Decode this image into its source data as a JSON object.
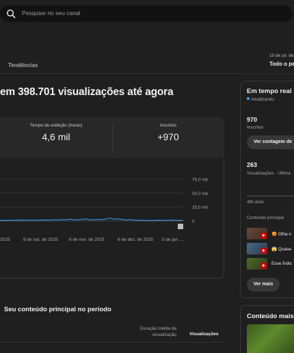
{
  "search": {
    "placeholder": "Pesquise no seu canal",
    "icon": "search-icon"
  },
  "nav": {
    "tab_trends": "Tendências"
  },
  "date_range": {
    "dates": "10 de jul. de",
    "label": "Todo o pe"
  },
  "headline": "em 398.701 visualizações até agora",
  "metrics": [
    {
      "label": "Tempo de exibição (horas)",
      "value": "4,6 mil"
    },
    {
      "label": "Inscritos",
      "value": "+970"
    }
  ],
  "chart_data": {
    "type": "line",
    "x_tick_labels": [
      "2025",
      "8 de out. de 2025",
      "6 de nov. de 2025",
      "6 de dez. de 2025",
      "5 de jan. ..."
    ],
    "y_tick_labels": [
      "0",
      "25,0 mil",
      "50,0 mil",
      "75,0 mil"
    ],
    "ylim": [
      0,
      75000
    ],
    "series": [
      {
        "color": "#3ea6ff",
        "values": [
          900,
          1100,
          1000,
          1300,
          1200,
          1500,
          1300,
          1400,
          1600,
          1200,
          1500,
          1800,
          1400,
          2200,
          1700,
          2600,
          1900,
          3500,
          2400,
          1800,
          2700,
          3800,
          2500,
          2000,
          2900,
          2200,
          3300,
          5200,
          3000,
          4100,
          2800,
          1900,
          2500,
          1600,
          1200,
          1100,
          1000,
          950,
          1000,
          1300,
          1100,
          1000,
          1600,
          1200,
          1000,
          900
        ]
      }
    ]
  },
  "section": {
    "title": "Seu conteúdo principal no período",
    "col_avg": "Duração média da visualização",
    "col_views": "Visualizações"
  },
  "realtime": {
    "title": "Em tempo real",
    "status": "Atualizando",
    "subs_value": "970",
    "subs_label": "Inscritos",
    "live_button": "Ver contagem de",
    "views_value": "263",
    "views_label": "Visualizações · Última",
    "hours_ago": "48h atrás",
    "top_content": "Conteúdo principal",
    "items": [
      {
        "text": "😡 Olha o"
      },
      {
        "text": "😱 Quase"
      },
      {
        "text": "Esse Índic"
      }
    ],
    "more_button": "Ver mais"
  },
  "content_card": {
    "title": "Conteúdo mais"
  },
  "colors": {
    "accent": "#3ea6ff",
    "background": "#1f1f1f",
    "panel": "#282828"
  }
}
